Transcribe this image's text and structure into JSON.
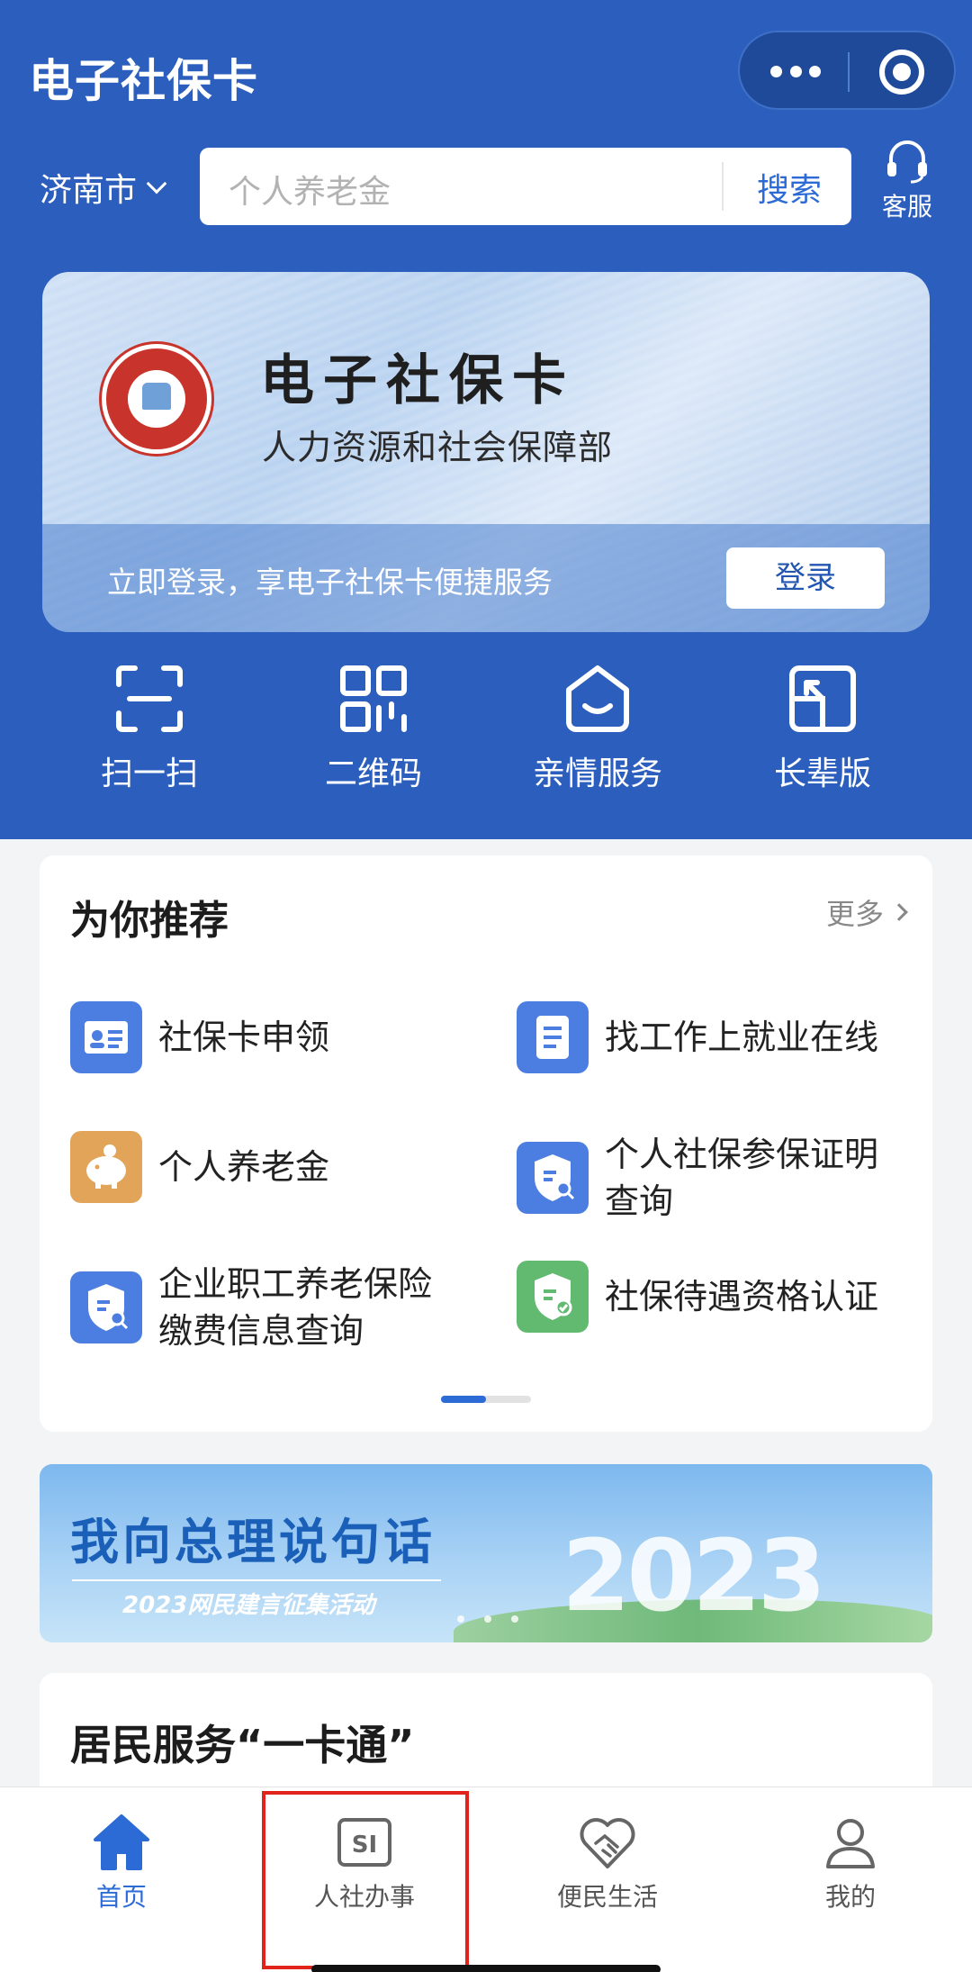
{
  "header": {
    "title": "电子社保卡",
    "city": "济南市",
    "search_placeholder": "个人养老金",
    "search_button": "搜索",
    "service_label": "客服"
  },
  "card": {
    "title": "电子社保卡",
    "subtitle": "人力资源和社会保障部",
    "login_tip": "立即登录，享电子社保卡便捷服务",
    "login_button": "登录"
  },
  "quick_actions": [
    {
      "label": "扫一扫",
      "icon": "scan-icon"
    },
    {
      "label": "二维码",
      "icon": "qrcode-icon"
    },
    {
      "label": "亲情服务",
      "icon": "family-service-icon"
    },
    {
      "label": "长辈版",
      "icon": "elder-mode-icon"
    }
  ],
  "recommend": {
    "title": "为你推荐",
    "more": "更多",
    "items": [
      {
        "label": "社保卡申领",
        "icon": "id-card-icon",
        "color": "#4b7ee0"
      },
      {
        "label": "找工作上就业在线",
        "icon": "document-icon",
        "color": "#4b7ee0"
      },
      {
        "label": "个人养老金",
        "icon": "piggy-bank-icon",
        "color": "#e2a459"
      },
      {
        "label_line1": "个人社保参保证明",
        "label_line2": "查询",
        "icon": "shield-search-icon",
        "color": "#4b7ee0"
      },
      {
        "label_line1": "企业职工养老保险",
        "label_line2": "缴费信息查询",
        "icon": "shield-search-icon",
        "color": "#4b7ee0"
      },
      {
        "label": "社保待遇资格认证",
        "icon": "shield-check-icon",
        "color": "#62b970"
      }
    ],
    "page_indicator": {
      "current": 1,
      "total": 2
    }
  },
  "promo": {
    "title": "我向总理说句话",
    "subtitle": "2023网民建言征集活动",
    "year": "2023"
  },
  "residents": {
    "title": "居民服务“一卡通”"
  },
  "tabbar": {
    "tabs": [
      {
        "label": "首页",
        "icon": "home-icon",
        "active": true
      },
      {
        "label": "人社办事",
        "icon": "si-icon",
        "active": false
      },
      {
        "label": "便民生活",
        "icon": "heart-handshake-icon",
        "active": false
      },
      {
        "label": "我的",
        "icon": "user-icon",
        "active": false
      }
    ]
  },
  "colors": {
    "brand_blue": "#2c5fbd",
    "accent": "#2c6bd6",
    "highlight_red": "#e0241b"
  }
}
